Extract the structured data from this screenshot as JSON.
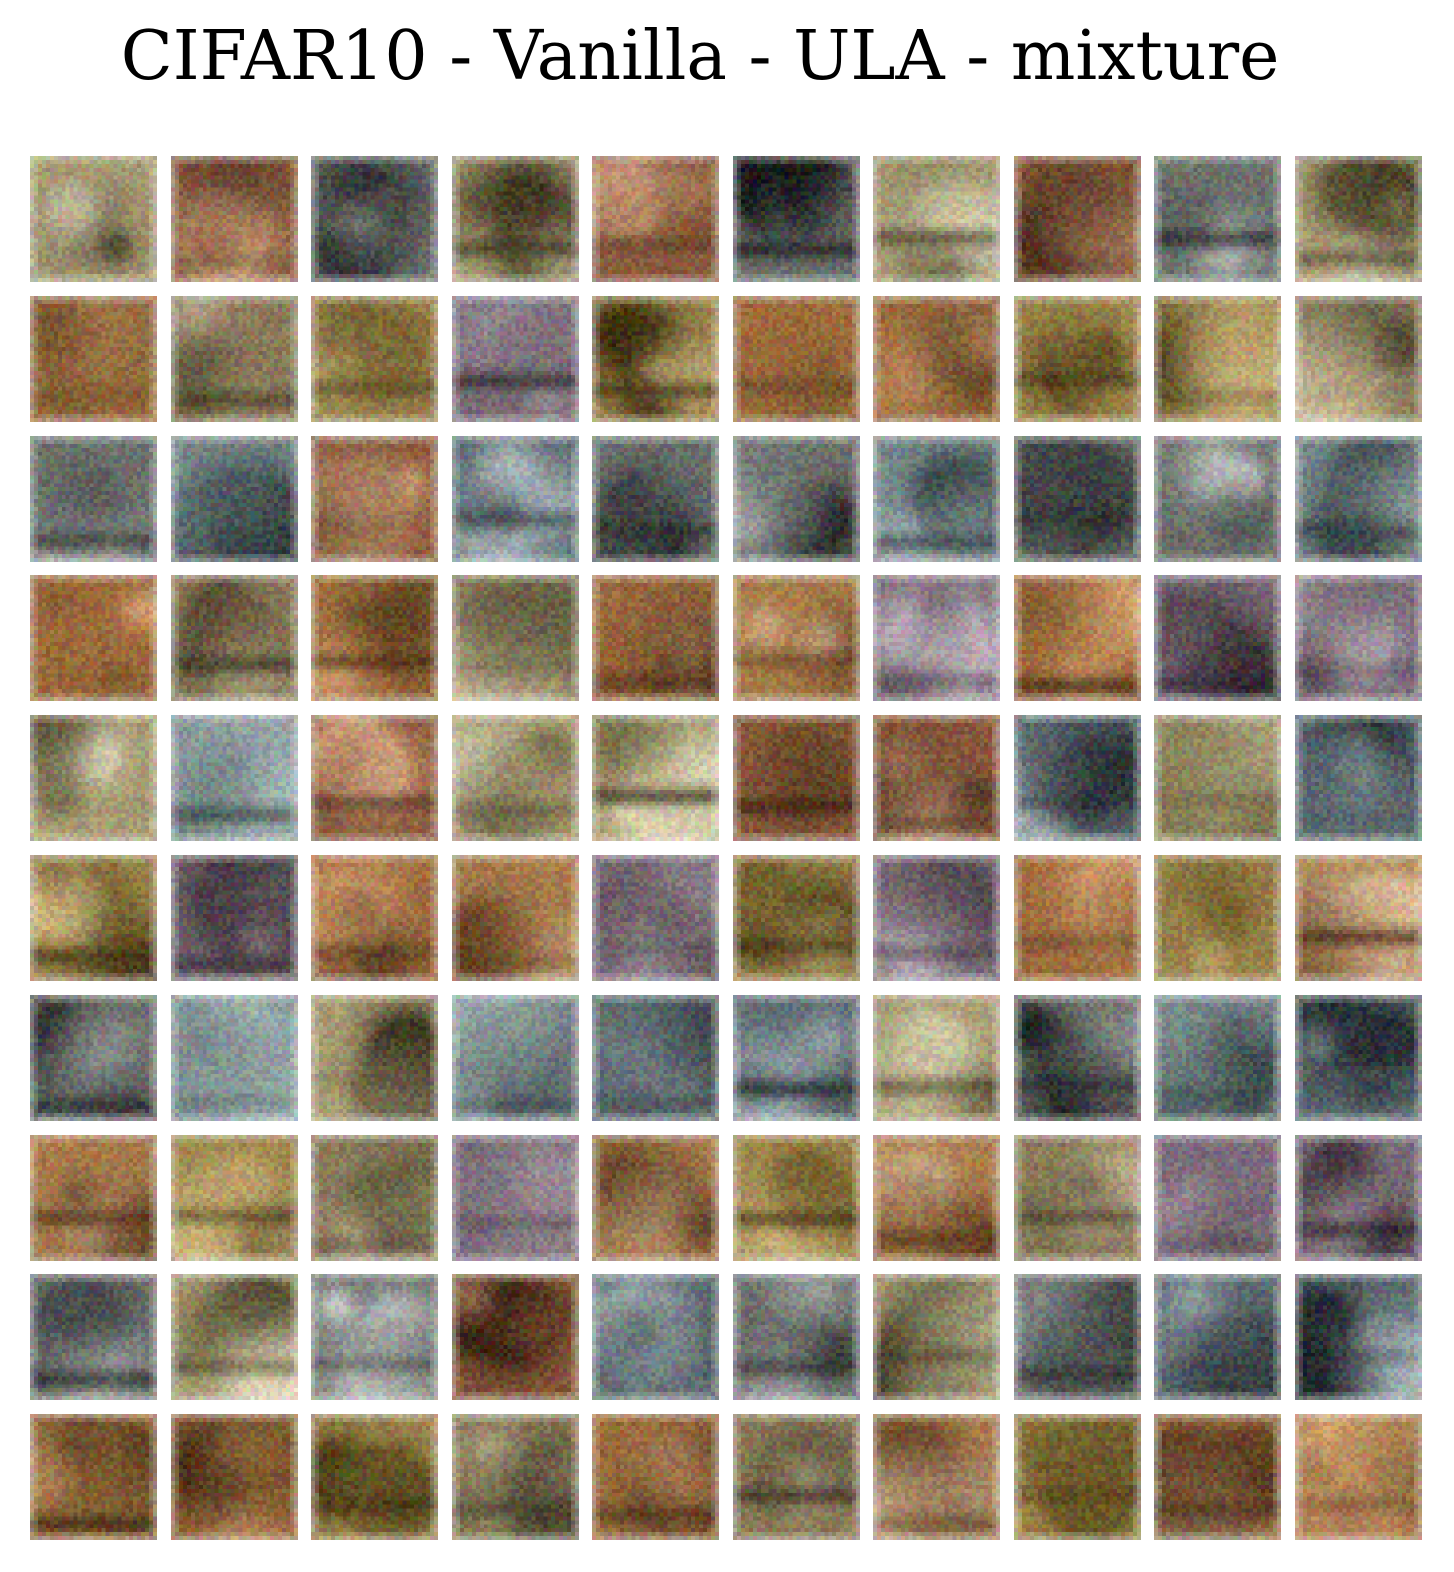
{
  "title": "CIFAR10 - Vanilla - ULA - mixture",
  "grid": {
    "rows": 10,
    "cols": 10
  },
  "palette": [
    [
      "#8a7a5a",
      "#3c3222",
      "#c8b896",
      "#5e5a3c"
    ],
    [
      "#8a5a3c",
      "#3c2414",
      "#c89c78",
      "#6e4a2c"
    ],
    [
      "#9c6a3c",
      "#3a2410",
      "#d4a070",
      "#7a5a30"
    ],
    [
      "#7a8a8c",
      "#2a3436",
      "#b4c4c4",
      "#4c5c5c"
    ],
    [
      "#7a6c78",
      "#2a2228",
      "#c4b8c0",
      "#54484e"
    ],
    [
      "#5c6a70",
      "#1e2428",
      "#a8b4b8",
      "#3c4448"
    ],
    [
      "#a87c4c",
      "#4a2c14",
      "#dcc09c",
      "#7c5430"
    ],
    [
      "#a89c74",
      "#3c3420",
      "#e0d8b8",
      "#6c6440"
    ],
    [
      "#9c844c",
      "#3e3010",
      "#d4bc84",
      "#6c5a28"
    ],
    [
      "#6c706c",
      "#1a1c1c",
      "#c4c8c4",
      "#4c5050"
    ]
  ],
  "tile_seeds": [
    11,
    23,
    37,
    41,
    53,
    67,
    71,
    83,
    97,
    101,
    113,
    127,
    131,
    149,
    151,
    163,
    173,
    181,
    191,
    197,
    211,
    223,
    227,
    239,
    241,
    251,
    263,
    271,
    281,
    293,
    307,
    311,
    317,
    331,
    347,
    349,
    353,
    367,
    373,
    383,
    389,
    397,
    401,
    409,
    419,
    421,
    431,
    433,
    439,
    443,
    449,
    457,
    461,
    463,
    467,
    479,
    487,
    491,
    499,
    503,
    509,
    521,
    523,
    541,
    547,
    557,
    563,
    569,
    571,
    577,
    587,
    593,
    599,
    601,
    607,
    613,
    617,
    619,
    631,
    641,
    643,
    647,
    653,
    659,
    661,
    673,
    677,
    683,
    691,
    701,
    709,
    719,
    727,
    733,
    739,
    743,
    751,
    757,
    761,
    769
  ]
}
